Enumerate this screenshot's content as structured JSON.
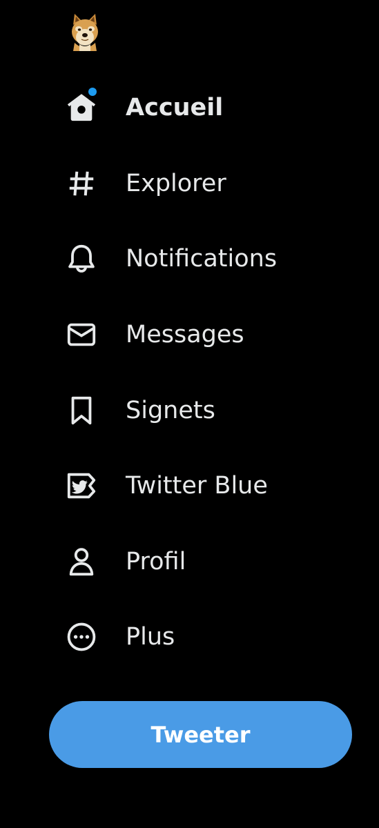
{
  "colors": {
    "background": "#000000",
    "text": "#e7e9ea",
    "accent": "#1d9bf0",
    "tweet_button": "#4a9be6"
  },
  "logo": {
    "icon": "doge-avatar-icon"
  },
  "nav": {
    "items": [
      {
        "label": "Accueil",
        "icon": "home-icon",
        "active": true,
        "has_notification_dot": true
      },
      {
        "label": "Explorer",
        "icon": "hashtag-icon",
        "active": false
      },
      {
        "label": "Notifications",
        "icon": "bell-icon",
        "active": false
      },
      {
        "label": "Messages",
        "icon": "envelope-icon",
        "active": false
      },
      {
        "label": "Signets",
        "icon": "bookmark-icon",
        "active": false
      },
      {
        "label": "Twitter Blue",
        "icon": "twitter-blue-icon",
        "active": false
      },
      {
        "label": "Profil",
        "icon": "person-icon",
        "active": false
      },
      {
        "label": "Plus",
        "icon": "more-circle-icon",
        "active": false
      }
    ]
  },
  "tweet_button": {
    "label": "Tweeter"
  }
}
